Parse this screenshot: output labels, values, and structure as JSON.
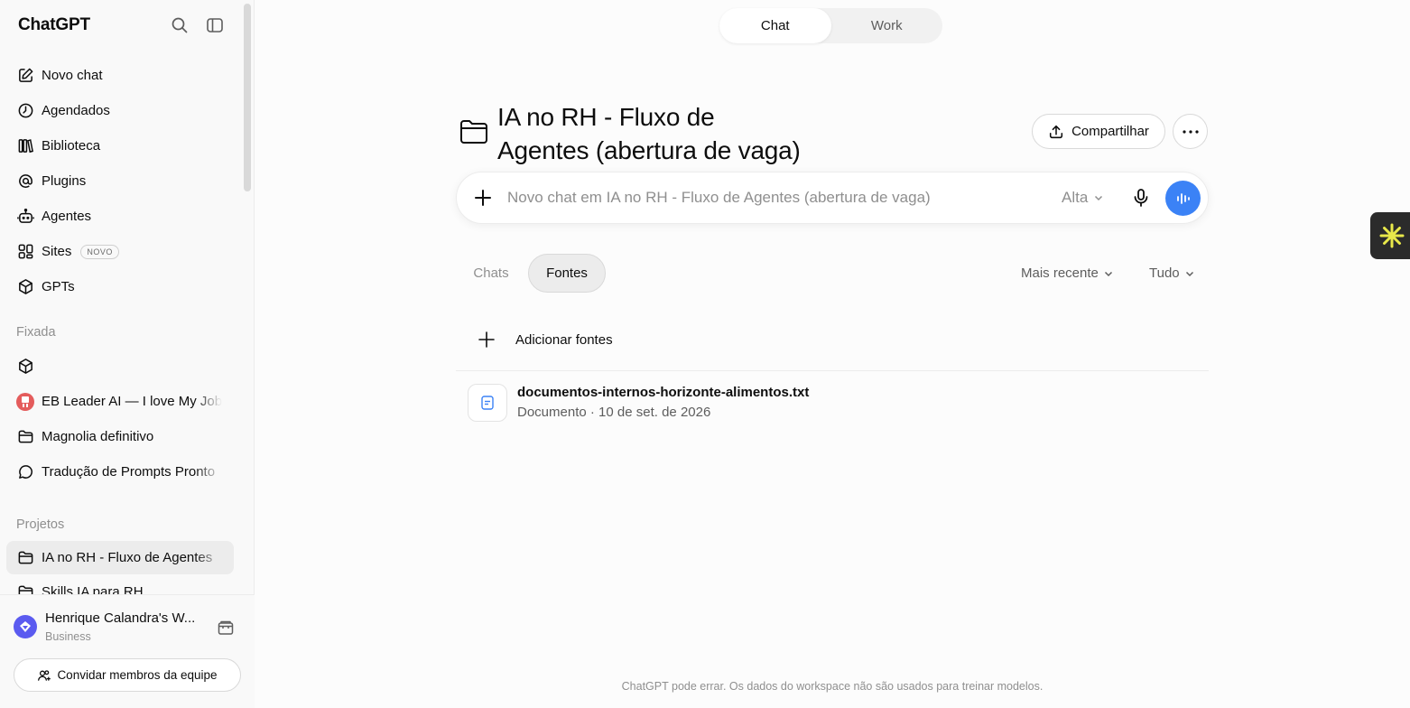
{
  "sidebar": {
    "brand": "ChatGPT",
    "nav": [
      {
        "label": "Novo chat",
        "icon": "edit-icon"
      },
      {
        "label": "Agendados",
        "icon": "clock-icon"
      },
      {
        "label": "Biblioteca",
        "icon": "library-icon"
      },
      {
        "label": "Plugins",
        "icon": "at-sign-icon"
      },
      {
        "label": "Agentes",
        "icon": "robot-icon"
      },
      {
        "label": "Sites",
        "icon": "grid-icon",
        "badge": "NOVO"
      },
      {
        "label": "GPTs",
        "icon": "cube-icon"
      }
    ],
    "pinned_label": "Fixada",
    "pinned": [
      {
        "label": "",
        "icon": "cube-icon"
      },
      {
        "label": "EB Leader AI — I love My Job",
        "icon": "avatar-icon"
      },
      {
        "label": "Magnolia definitivo",
        "icon": "folder-icon"
      },
      {
        "label": "Tradução de Prompts Pronto",
        "icon": "chat-bubble-icon"
      }
    ],
    "projects_label": "Projetos",
    "projects": [
      {
        "label": "IA no RH - Fluxo de Agentes",
        "icon": "folder-icon",
        "active": true
      },
      {
        "label": "Skills IA para RH",
        "icon": "folder-icon"
      }
    ],
    "workspace": {
      "name": "Henrique Calandra's W...",
      "plan": "Business"
    },
    "invite_label": "Convidar membros da equipe"
  },
  "toggle": {
    "chat": "Chat",
    "work": "Work",
    "selected": "Chat"
  },
  "project": {
    "title_line1": "IA no RH - Fluxo de",
    "title_line2": "Agentes (abertura de vaga)"
  },
  "share_label": "Compartilhar",
  "composer": {
    "placeholder": "Novo chat em IA no RH - Fluxo de Agentes (abertura de vaga)",
    "model": "Alta"
  },
  "tabs": {
    "chats": "Chats",
    "fontes": "Fontes",
    "selected": "Fontes"
  },
  "filters": {
    "sort": "Mais recente",
    "scope": "Tudo"
  },
  "add_sources_label": "Adicionar fontes",
  "files": [
    {
      "name": "documentos-internos-horizonte-alimentos.txt",
      "meta": "Documento · 10 de set. de 2026"
    }
  ],
  "footer_note": "ChatGPT pode errar. Os dados do workspace não são usados para treinar modelos.",
  "colors": {
    "accent": "#3b82f6",
    "workspace_avatar": "#5b5bf0",
    "extension": "#2b2b2b"
  }
}
